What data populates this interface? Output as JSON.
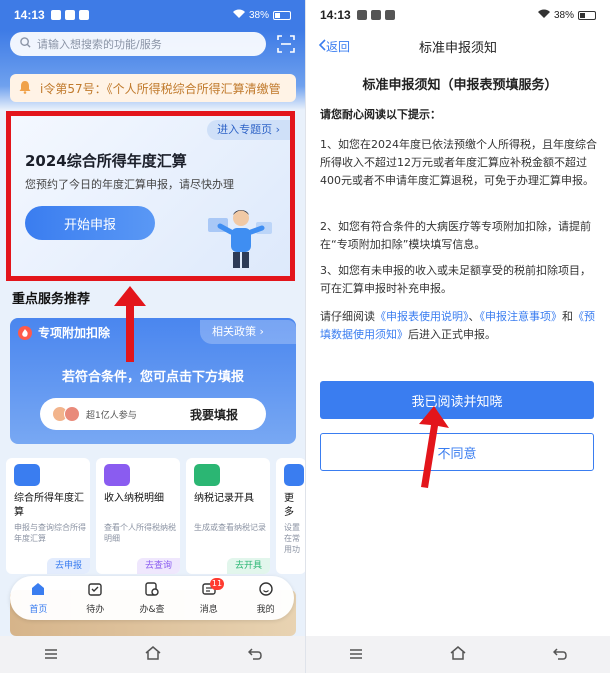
{
  "left": {
    "status": {
      "time": "14:13",
      "battery": "38%"
    },
    "search": {
      "placeholder": "请输入想搜索的功能/服务"
    },
    "notice": {
      "text": "i令第57号：《个人所得税综合所得汇算清缴管"
    },
    "annual": {
      "topic_link": "进入专题页",
      "title": "2024综合所得年度汇算",
      "desc": "您预约了今日的年度汇算申报，请尽快办理",
      "start_button": "开始申报"
    },
    "section_title": "重点服务推荐",
    "deduction": {
      "title": "专项附加扣除",
      "policy_link": "相关政策",
      "message": "若符合条件，您可点击下方填报",
      "participants": "超1亿人参与",
      "fill_button": "我要填报"
    },
    "services": [
      {
        "name": "综合所得年度汇算",
        "desc": "申报与查询综合所得年度汇算",
        "action": "去申报",
        "color": "#3a7df0"
      },
      {
        "name": "收入纳税明细",
        "desc": "查看个人所得税纳税明细",
        "action": "去查询",
        "color": "#8a5cf0"
      },
      {
        "name": "纳税记录开具",
        "desc": "生成或查看纳税记录",
        "action": "去开具",
        "color": "#2bb673"
      },
      {
        "name": "更多",
        "desc": "设置在常用功",
        "action": "",
        "color": "#3a7df0"
      }
    ],
    "tabs": [
      {
        "label": "首页",
        "icon": "home-icon"
      },
      {
        "label": "待办",
        "icon": "todo-icon"
      },
      {
        "label": "办&查",
        "icon": "search-doc-icon"
      },
      {
        "label": "消息",
        "icon": "message-icon",
        "badge": "11"
      },
      {
        "label": "我的",
        "icon": "profile-icon"
      }
    ]
  },
  "right": {
    "status": {
      "time": "14:13",
      "battery": "38%"
    },
    "back_label": "返回",
    "page_title": "标准申报须知",
    "doc_title": "标准申报须知（申报表预填服务）",
    "lead": "请您耐心阅读以下提示：",
    "p1": "1、如您在2024年度已依法预缴个人所得税，且年度综合所得收入不超过12万元或者年度汇算应补税金额不超过400元或者不申请年度汇算退税，可免于办理汇算申报。",
    "p2": "2、如您有符合条件的大病医疗等专项附加扣除，请提前在“专项附加扣除”模块填写信息。",
    "p3": "3、如您有未申报的收入或未足额享受的税前扣除项目，可在汇算申报时补充申报。",
    "p4": {
      "pre": "请仔细阅读",
      "link1": "《申报表使用说明》",
      "sep1": "、",
      "link2": "《申报注意事项》",
      "sep2": "和",
      "link3": "《预填数据使用须知》",
      "post": "后进入正式申报。"
    },
    "agree_button": "我已阅读并知晓",
    "disagree_button": "不同意"
  },
  "colors": {
    "primary": "#3a7df0",
    "highlight": "#e3151b"
  }
}
